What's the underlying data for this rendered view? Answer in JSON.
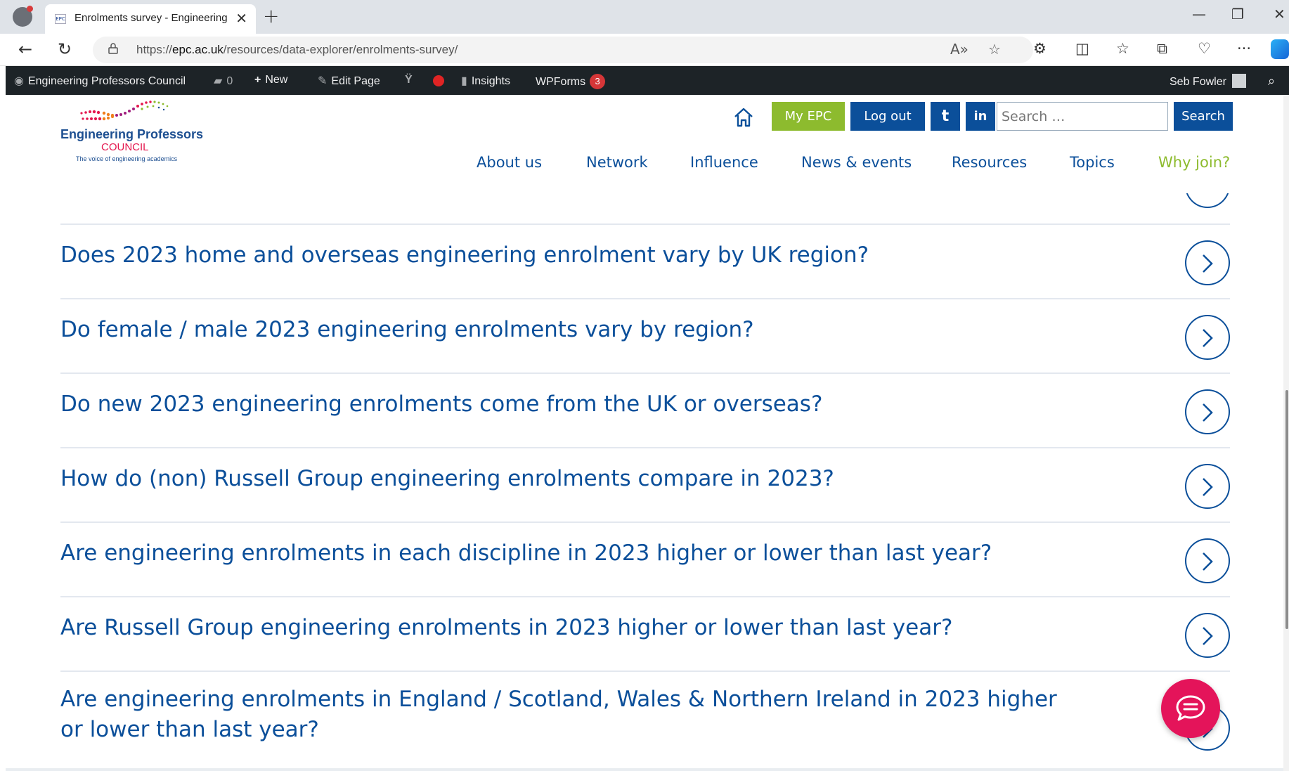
{
  "browser": {
    "tab_title": "Enrolments survey - Engineering",
    "tab_favicon": "EPC",
    "url_domain": "epc.ac.uk",
    "url_path": "/resources/data-explorer/enrolments-survey/",
    "url_scheme": "https://"
  },
  "adminbar": {
    "site_name": "Engineering Professors Council",
    "comments_count": "0",
    "new_label": "New",
    "edit_label": "Edit Page",
    "insights_label": "Insights",
    "wpforms_label": "WPForms",
    "wpforms_count": "3",
    "user_name": "Seb Fowler"
  },
  "header": {
    "logo_line1": "Engineering Professors",
    "logo_line2": "COUNCIL",
    "logo_tagline": "The voice of engineering academics",
    "my_epc_label": "My EPC",
    "logout_label": "Log out",
    "twitter_glyph": "t",
    "linkedin_glyph": "in",
    "search_placeholder": "Search …",
    "search_button": "Search"
  },
  "nav": {
    "items": [
      "About us",
      "Network",
      "Influence",
      "News & events",
      "Resources",
      "Topics"
    ],
    "join_label": "Why join?"
  },
  "faq": {
    "questions": [
      "Does 2023 home and overseas engineering enrolment vary by UK region?",
      "Do female / male 2023 engineering enrolments vary by region?",
      "Do new 2023 engineering enrolments come from the UK or overseas?",
      "How do (non) Russell Group engineering enrolments compare in 2023?",
      "Are engineering enrolments in each discipline in 2023 higher or lower than last year?",
      "Are Russell Group engineering enrolments in 2023 higher or lower than last year?",
      "Are engineering enrolments in England / Scotland, Wales & Northern Ireland in 2023 higher or lower than last year?"
    ]
  },
  "colors": {
    "brand_blue": "#0b4f9a",
    "brand_green": "#8dbb2e",
    "brand_pink": "#e4145a",
    "admin_bar": "#1d2327"
  },
  "icons": [
    "home-icon",
    "twitter-icon",
    "linkedin-icon",
    "chevron-right-icon",
    "chat-icon",
    "search-icon"
  ]
}
